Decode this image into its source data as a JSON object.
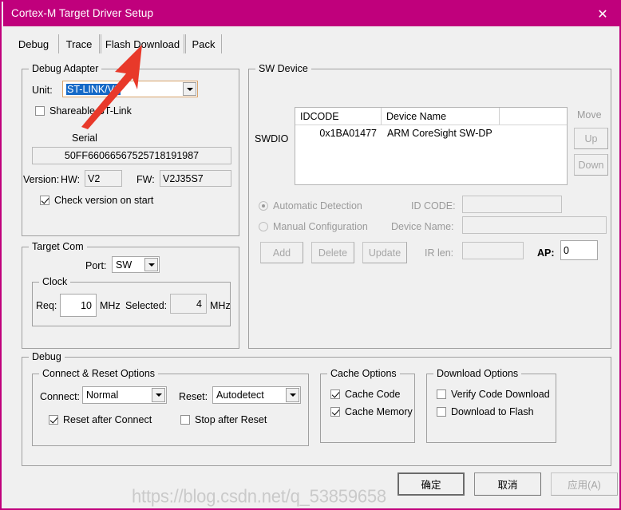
{
  "window": {
    "title": "Cortex-M Target Driver Setup",
    "close_icon": "close-icon",
    "titlebar_color": "#C0007C"
  },
  "tabs": [
    {
      "label": "Debug",
      "selected": true
    },
    {
      "label": "Trace",
      "selected": false
    },
    {
      "label": "Flash Download",
      "selected": false
    },
    {
      "label": "Pack",
      "selected": false
    }
  ],
  "debug_adapter": {
    "group_title": "Debug Adapter",
    "unit_label": "Unit:",
    "unit_value": "ST-LINK/V2",
    "shareable_label": "Shareable ST-Link",
    "shareable_checked": false,
    "serial_label": "Serial",
    "serial_value": "50FF66066567525718191987",
    "version_label": "Version:",
    "hw_label": "HW:",
    "hw_value": "V2",
    "fw_label": "FW:",
    "fw_value": "V2J35S7",
    "check_version_label": "Check version on start",
    "check_version_checked": true
  },
  "target_com": {
    "group_title": "Target Com",
    "port_label": "Port:",
    "port_value": "SW",
    "clock_group_title": "Clock",
    "req_label": "Req:",
    "req_value": "10",
    "req_unit": "MHz",
    "selected_label": "Selected:",
    "selected_value": "4",
    "selected_unit": "MHz"
  },
  "sw_device": {
    "group_title": "SW Device",
    "swdio_label": "SWDIO",
    "columns": [
      "IDCODE",
      "Device Name",
      ""
    ],
    "rows": [
      {
        "idcode": "0x1BA01477",
        "device_name": "ARM CoreSight SW-DP",
        "extra": ""
      }
    ],
    "move_label": "Move",
    "up_label": "Up",
    "down_label": "Down",
    "automatic_detection_label": "Automatic Detection",
    "automatic_detection_selected": true,
    "manual_configuration_label": "Manual Configuration",
    "manual_configuration_selected": false,
    "id_code_label": "ID CODE:",
    "id_code_value": "",
    "device_name_label": "Device Name:",
    "device_name_value": "",
    "ir_len_label": "IR len:",
    "ir_len_value": "",
    "ap_label": "AP:",
    "ap_value": "0",
    "add_label": "Add",
    "delete_label": "Delete",
    "update_label": "Update"
  },
  "debug_section": {
    "group_title": "Debug",
    "connect_reset": {
      "group_title": "Connect & Reset Options",
      "connect_label": "Connect:",
      "connect_value": "Normal",
      "reset_label": "Reset:",
      "reset_value": "Autodetect",
      "reset_after_connect_label": "Reset after Connect",
      "reset_after_connect_checked": true,
      "stop_after_reset_label": "Stop after Reset",
      "stop_after_reset_checked": false
    },
    "cache": {
      "group_title": "Cache Options",
      "cache_code_label": "Cache Code",
      "cache_code_checked": true,
      "cache_memory_label": "Cache Memory",
      "cache_memory_checked": true
    },
    "download": {
      "group_title": "Download Options",
      "verify_code_label": "Verify Code Download",
      "verify_code_checked": false,
      "download_to_flash_label": "Download to Flash",
      "download_to_flash_checked": false
    }
  },
  "footer": {
    "ok_label": "确定",
    "cancel_label": "取消",
    "apply_label": "应用(A)"
  },
  "watermark": {
    "text": "https://blog.csdn.net/q_53859658"
  }
}
